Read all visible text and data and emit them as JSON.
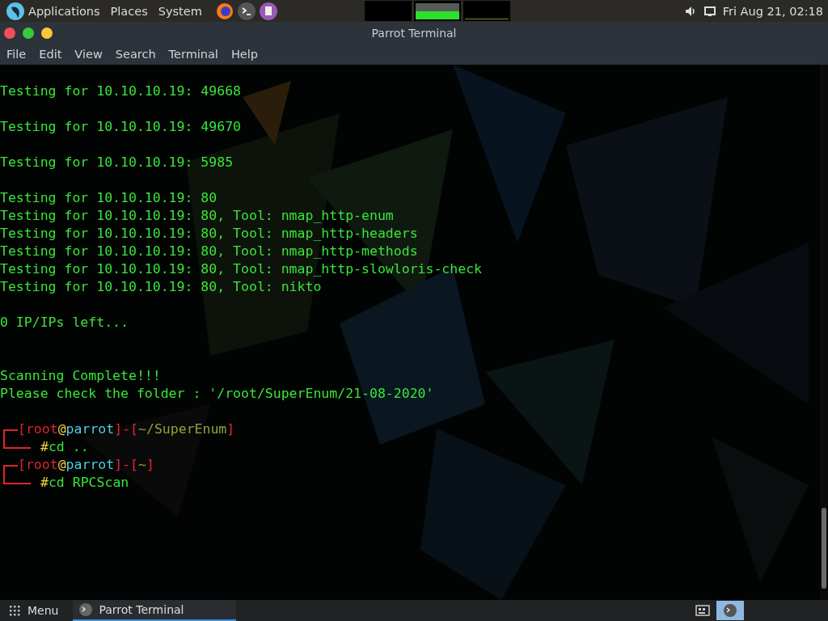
{
  "top_panel": {
    "menus": [
      "Applications",
      "Places",
      "System"
    ],
    "clock": "Fri Aug 21, 02:18"
  },
  "window": {
    "title": "Parrot Terminal"
  },
  "menubar": [
    "File",
    "Edit",
    "View",
    "Search",
    "Terminal",
    "Help"
  ],
  "terminal": {
    "lines": [
      {
        "kind": "blank"
      },
      {
        "kind": "output",
        "text": "Testing for 10.10.10.19: 49668"
      },
      {
        "kind": "blank"
      },
      {
        "kind": "output",
        "text": "Testing for 10.10.10.19: 49670"
      },
      {
        "kind": "blank"
      },
      {
        "kind": "output",
        "text": "Testing for 10.10.10.19: 5985"
      },
      {
        "kind": "blank"
      },
      {
        "kind": "output",
        "text": "Testing for 10.10.10.19: 80"
      },
      {
        "kind": "output",
        "text": "Testing for 10.10.10.19: 80, Tool: nmap_http-enum"
      },
      {
        "kind": "output",
        "text": "Testing for 10.10.10.19: 80, Tool: nmap_http-headers"
      },
      {
        "kind": "output",
        "text": "Testing for 10.10.10.19: 80, Tool: nmap_http-methods"
      },
      {
        "kind": "output",
        "text": "Testing for 10.10.10.19: 80, Tool: nmap_http-slowloris-check"
      },
      {
        "kind": "output",
        "text": "Testing for 10.10.10.19: 80, Tool: nikto"
      },
      {
        "kind": "blank"
      },
      {
        "kind": "output",
        "text": "0 IP/IPs left..."
      },
      {
        "kind": "blank"
      },
      {
        "kind": "blank"
      },
      {
        "kind": "output",
        "text": "Scanning Complete!!!"
      },
      {
        "kind": "output",
        "text": "Please check the folder : '/root/SuperEnum/21-08-2020'"
      },
      {
        "kind": "blank"
      },
      {
        "kind": "prompt",
        "open": "[",
        "user": "root",
        "at": "@",
        "host": "parrot",
        "separator": "]-[",
        "path": "~/SuperEnum",
        "close": "]"
      },
      {
        "kind": "command",
        "hash": "#",
        "command": "cd .."
      },
      {
        "kind": "prompt",
        "open": "[",
        "user": "root",
        "at": "@",
        "host": "parrot",
        "separator": "]-[",
        "path": "~",
        "close": "]"
      },
      {
        "kind": "command",
        "hash": "#",
        "command": "cd RPCScan"
      }
    ]
  },
  "taskbar": {
    "menu": "Menu",
    "tasks": [
      {
        "label": "Parrot Terminal",
        "selected": true
      }
    ]
  }
}
